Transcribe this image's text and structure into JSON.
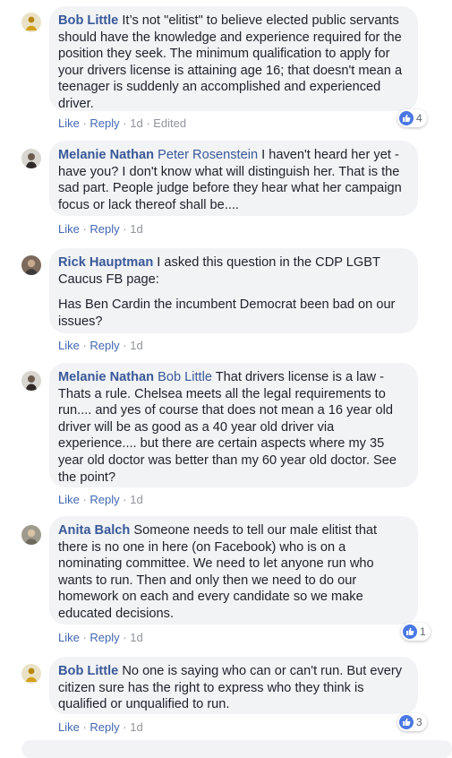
{
  "comments": [
    {
      "author": "Bob Little",
      "tag": "",
      "paragraphs": [
        "It’s not \"elitist\" to believe elected public servants should have the knowledge and experience required for the position they seek. The minimum qualification to apply for your drivers license is attaining age 16; that doesn't mean a teenager is suddenly an accomplished and experienced driver."
      ],
      "like": "Like",
      "reply": "Reply",
      "time": "1d",
      "edited": "Edited",
      "reaction_count": "4"
    },
    {
      "author": "Melanie Nathan",
      "tag": "Peter Rosenstein",
      "paragraphs": [
        "I haven't heard her yet - have you? I don't know what will distinguish her. That is the sad part. People judge before they hear what her campaign focus or lack thereof shall be...."
      ],
      "like": "Like",
      "reply": "Reply",
      "time": "1d"
    },
    {
      "author": "Rick Hauptman",
      "tag": "",
      "paragraphs": [
        "I asked this question in the CDP LGBT Caucus FB page:",
        "Has Ben Cardin the incumbent Democrat been bad on our issues?"
      ],
      "like": "Like",
      "reply": "Reply",
      "time": "1d"
    },
    {
      "author": "Melanie Nathan",
      "tag": "Bob Little",
      "paragraphs": [
        "That drivers license is a law - Thats a rule. Chelsea meets all the legal requirements to run.... and yes of course that does not mean a 16 year old driver will be as good as a 40 year old driver via experience.... but there are certain aspects where my 35 year old doctor was better than my 60 year old doctor. See the point?"
      ],
      "like": "Like",
      "reply": "Reply",
      "time": "1d"
    },
    {
      "author": "Anita Balch",
      "tag": "",
      "paragraphs": [
        "Someone needs to tell our male elitist that there is no one in here (on Facebook) who is on a nominating committee. We need to let anyone run who wants to run. Then and only then we need to do our homework on each and every candidate so we make educated decisions."
      ],
      "like": "Like",
      "reply": "Reply",
      "time": "1d",
      "reaction_count": "1"
    },
    {
      "author": "Bob Little",
      "tag": "",
      "paragraphs": [
        "No one is saying who can or can't run. But every citizen sure has the right to express who they think is qualified or unqualified to run."
      ],
      "like": "Like",
      "reply": "Reply",
      "time": "1d",
      "reaction_count": "3"
    }
  ],
  "colors": {
    "link": "#385898",
    "action_link": "#4267b2",
    "bubble": "#f2f3f5",
    "meta": "#90949c",
    "like_icon": "#4a78e4"
  },
  "icons": {
    "avatar": "user-avatar-icon",
    "reaction": "thumbs-up-icon"
  }
}
